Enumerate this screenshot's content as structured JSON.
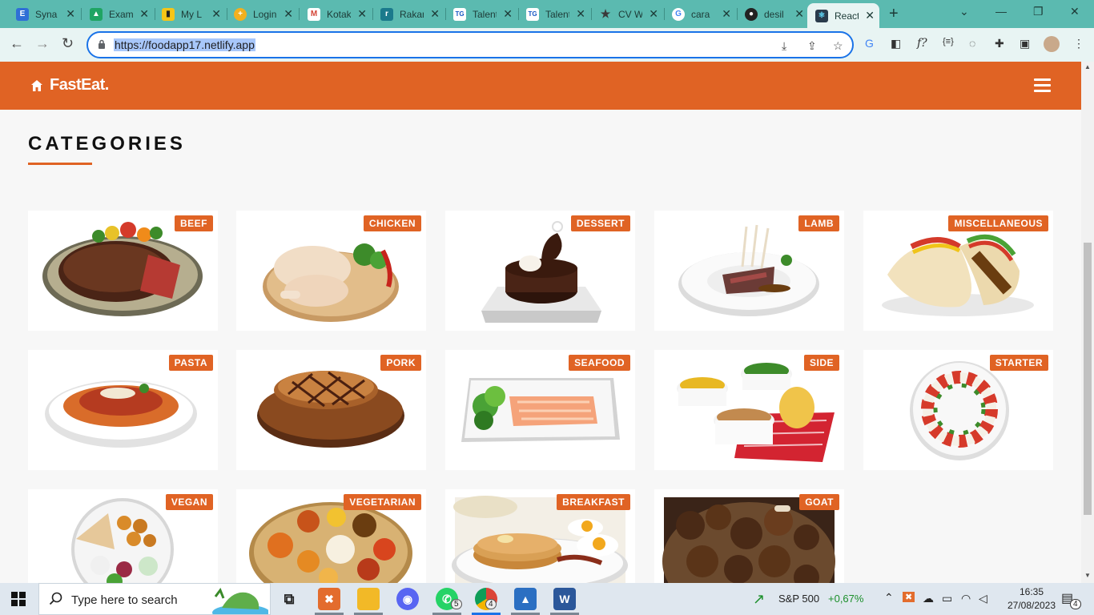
{
  "browser": {
    "tabs": [
      {
        "title": "Syna",
        "icon": "doc-icon",
        "color": "#2f6fd6",
        "glyph": "E"
      },
      {
        "title": "Exam",
        "icon": "drive-icon",
        "color": "#1fa463",
        "glyph": "▲"
      },
      {
        "title": "My L",
        "icon": "app-icon",
        "color": "#f5c518",
        "glyph": "▮"
      },
      {
        "title": "Login",
        "icon": "plus-icon",
        "color": "#f2b01e",
        "glyph": "+"
      },
      {
        "title": "Kotak",
        "icon": "gmail-icon",
        "color": "#d44638",
        "glyph": "M"
      },
      {
        "title": "Rakam",
        "icon": "app-icon",
        "color": "#1b7a8c",
        "glyph": "r"
      },
      {
        "title": "Talent",
        "icon": "tg-icon",
        "color": "#1456c4",
        "glyph": "TG"
      },
      {
        "title": "Talent",
        "icon": "tg-icon",
        "color": "#1456c4",
        "glyph": "TG"
      },
      {
        "title": "CV W",
        "icon": "star-icon",
        "color": "#3a3a3a",
        "glyph": "★"
      },
      {
        "title": "cara",
        "icon": "google-icon",
        "color": "#4285f4",
        "glyph": "G"
      },
      {
        "title": "desil",
        "icon": "github-icon",
        "color": "#222222",
        "glyph": "●"
      },
      {
        "title": "React",
        "icon": "react-icon",
        "color": "#2a3b4c",
        "glyph": "⚛"
      }
    ],
    "url": "https://foodapp17.netlify.app"
  },
  "app": {
    "brand": "FastEat.",
    "accent": "#e06324",
    "section_title": "CATEGORIES",
    "categories": [
      {
        "label": "BEEF"
      },
      {
        "label": "CHICKEN"
      },
      {
        "label": "DESSERT"
      },
      {
        "label": "LAMB"
      },
      {
        "label": "MISCELLANEOUS"
      },
      {
        "label": "PASTA"
      },
      {
        "label": "PORK"
      },
      {
        "label": "SEAFOOD"
      },
      {
        "label": "SIDE"
      },
      {
        "label": "STARTER"
      },
      {
        "label": "VEGAN"
      },
      {
        "label": "VEGETARIAN"
      },
      {
        "label": "BREAKFAST"
      },
      {
        "label": "GOAT"
      }
    ]
  },
  "taskbar": {
    "search_placeholder": "Type here to search",
    "whatsapp_badge": "5",
    "chrome_badge": "4",
    "stock_name": "S&P 500",
    "stock_change": "+0,67%",
    "time": "16:35",
    "date": "27/08/2023",
    "notification_count": "4"
  }
}
